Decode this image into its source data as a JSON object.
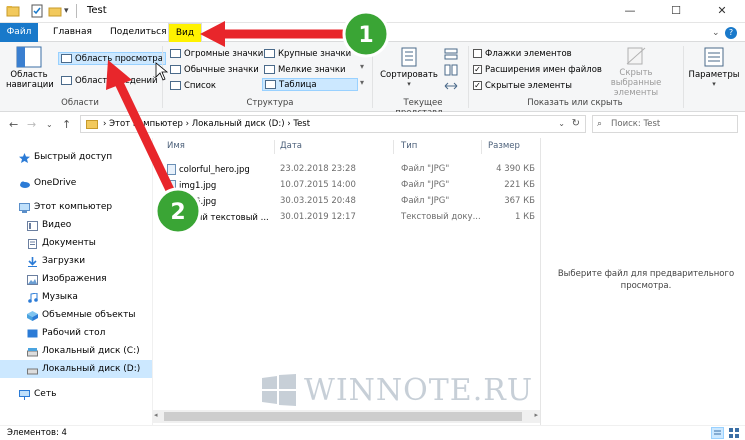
{
  "window": {
    "title": "Test",
    "controls": {
      "minimize": "—",
      "maximize": "☐",
      "close": "✕"
    }
  },
  "tabs": {
    "file": "Файл",
    "home": "Главная",
    "share": "Поделиться",
    "view": "Вид",
    "help": "?"
  },
  "ribbon": {
    "panes": {
      "nav_pane": "Область навигации",
      "preview_pane": "Область просмотра",
      "details_pane": "Область сведений",
      "group": "Области"
    },
    "layout": {
      "huge": "Огромные значки",
      "large": "Крупные значки",
      "normal": "Обычные значки",
      "small": "Мелкие значки",
      "list": "Список",
      "table": "Таблица",
      "group": "Структура"
    },
    "current_view": {
      "sort": "Сортировать",
      "group": "Текущее представл..."
    },
    "show_hide": {
      "item_checkboxes": "Флажки элементов",
      "file_extensions": "Расширения имен файлов",
      "hidden_items": "Скрытые элементы",
      "hide_selected": "Скрыть выбранные элементы",
      "group": "Показать или скрыть"
    },
    "options": "Параметры"
  },
  "address": {
    "path": "›  Этот компьютер  ›  Локальный диск (D:)  ›  Test",
    "search_placeholder": "Поиск: Test"
  },
  "sidebar": {
    "items": [
      {
        "label": "Быстрый доступ",
        "icon": "star-icon",
        "color": "#2b7bd6"
      },
      {
        "label": "OneDrive",
        "icon": "cloud-icon",
        "color": "#2b7bd6"
      },
      {
        "label": "Этот компьютер",
        "icon": "computer-icon",
        "color": "#5b8fc9"
      },
      {
        "label": "Видео",
        "icon": "video-icon",
        "color": "#6b7fa0"
      },
      {
        "label": "Документы",
        "icon": "documents-icon",
        "color": "#6b7fa0"
      },
      {
        "label": "Загрузки",
        "icon": "downloads-icon",
        "color": "#2b7bd6"
      },
      {
        "label": "Изображения",
        "icon": "pictures-icon",
        "color": "#6b7fa0"
      },
      {
        "label": "Музыка",
        "icon": "music-icon",
        "color": "#2b7bd6"
      },
      {
        "label": "Объемные объекты",
        "icon": "3d-objects-icon",
        "color": "#4aa3df"
      },
      {
        "label": "Рабочий стол",
        "icon": "desktop-icon",
        "color": "#2b7bd6"
      },
      {
        "label": "Локальный диск (C:)",
        "icon": "drive-c-icon",
        "color": "#777777"
      },
      {
        "label": "Локальный диск (D:)",
        "icon": "drive-d-icon",
        "color": "#777777"
      },
      {
        "label": "Сеть",
        "icon": "network-icon",
        "color": "#2b7bd6"
      }
    ]
  },
  "files": {
    "columns": {
      "name": "Имя",
      "date": "Дата",
      "type": "Тип",
      "size": "Размер"
    },
    "rows": [
      {
        "name": "colorful_hero.jpg",
        "date": "23.02.2018 23:28",
        "type": "Файл \"JPG\"",
        "size": "4 390 КБ"
      },
      {
        "name": "img1.jpg",
        "date": "10.07.2015 14:00",
        "type": "Файл \"JPG\"",
        "size": "221 КБ"
      },
      {
        "name": "img6.jpg",
        "date": "30.03.2015 20:48",
        "type": "Файл \"JPG\"",
        "size": "367 КБ"
      },
      {
        "name": "Новый текстовый ...",
        "date": "30.01.2019 12:17",
        "type": "Текстовый доку...",
        "size": "1 КБ"
      }
    ]
  },
  "preview": {
    "message": "Выберите файл для предварительного просмотра."
  },
  "status": {
    "items_count": "Элементов: 4"
  },
  "watermark": {
    "text": "WINNOTE.RU"
  },
  "annotations": {
    "badge_1": "1",
    "badge_2": "2",
    "arrow_color": "#e8262b",
    "badge_color": "#3aa535"
  }
}
